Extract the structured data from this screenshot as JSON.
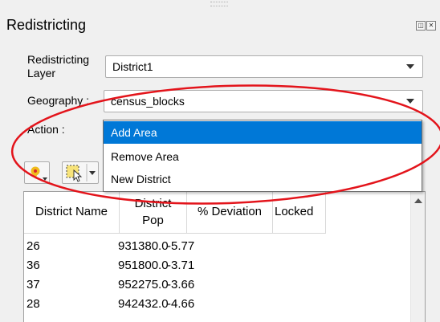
{
  "panel": {
    "title": "Redistricting"
  },
  "form": {
    "layer_label": "Redistricting\nLayer",
    "layer_value": "District1",
    "geography_label": "Geography :",
    "geography_value": "census_blocks",
    "action_label": "Action :"
  },
  "action_dropdown": {
    "options": [
      "Add Area",
      "Remove Area",
      "New District"
    ],
    "selected_index": 0
  },
  "table": {
    "columns": [
      "District Name",
      "District\nPop",
      "% Deviation",
      "Locked"
    ],
    "rows": [
      [
        "26",
        "931380.0",
        "-5.77",
        ""
      ],
      [
        "36",
        "951800.0",
        "-3.71",
        ""
      ],
      [
        "37",
        "952275.0",
        "-3.66",
        ""
      ],
      [
        "28",
        "942432.0",
        "-4.66",
        ""
      ]
    ]
  },
  "colors": {
    "highlight": "#0078d7",
    "annotation": "#e3141b"
  }
}
